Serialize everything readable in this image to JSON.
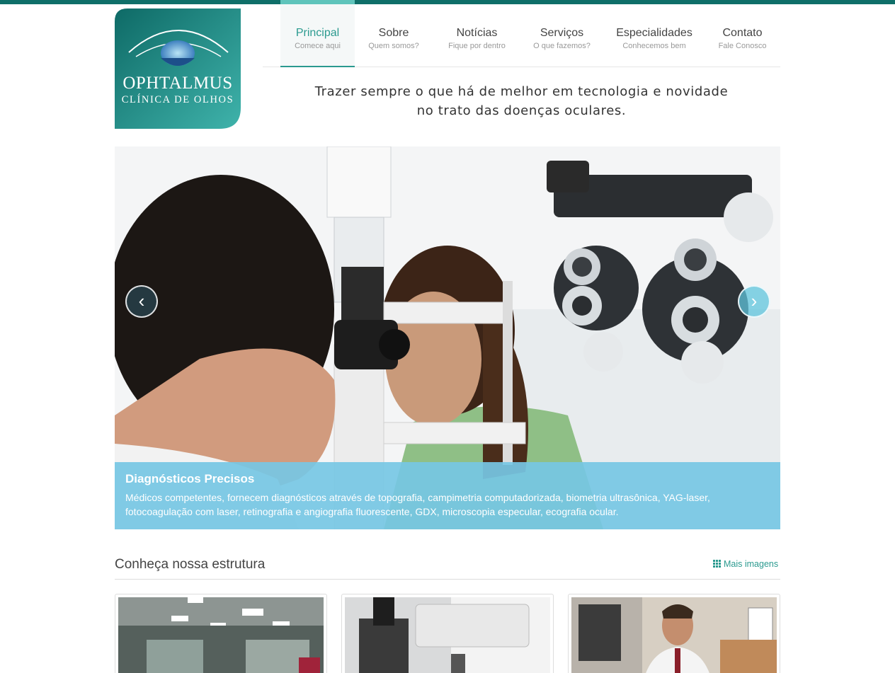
{
  "brand": {
    "name": "OPHTALMUS",
    "subtitle": "CLÍNICA DE OLHOS",
    "accent": "#0f6f69",
    "highlight": "#2b9a8f"
  },
  "nav": {
    "items": [
      {
        "label": "Principal",
        "sub": "Comece aqui",
        "active": true
      },
      {
        "label": "Sobre",
        "sub": "Quem somos?"
      },
      {
        "label": "Notícias",
        "sub": "Fique por dentro"
      },
      {
        "label": "Serviços",
        "sub": "O que fazemos?"
      },
      {
        "label": "Especialidades",
        "sub": "Conhecemos bem"
      },
      {
        "label": "Contato",
        "sub": "Fale Conosco"
      }
    ]
  },
  "tagline": {
    "line1": "Trazer sempre o que há de melhor em tecnologia e novidade",
    "line2": "no trato das doenças oculares."
  },
  "carousel": {
    "prev_icon": "chevron-left-icon",
    "next_icon": "chevron-right-icon",
    "prev_glyph": "‹",
    "next_glyph": "›",
    "caption_title": "Diagnósticos Precisos",
    "caption_text": "Médicos competentes, fornecem diagnósticos através de topografia, campimetria computadorizada, biometria ultrasônica, YAG-laser, fotocoagulação com laser, retinografia e angiografia fluorescente, GDX, microscopia especular, ecografia ocular."
  },
  "section": {
    "title": "Conheça nossa estrutura",
    "more_label": "Mais imagens",
    "more_icon": "grid-icon"
  }
}
